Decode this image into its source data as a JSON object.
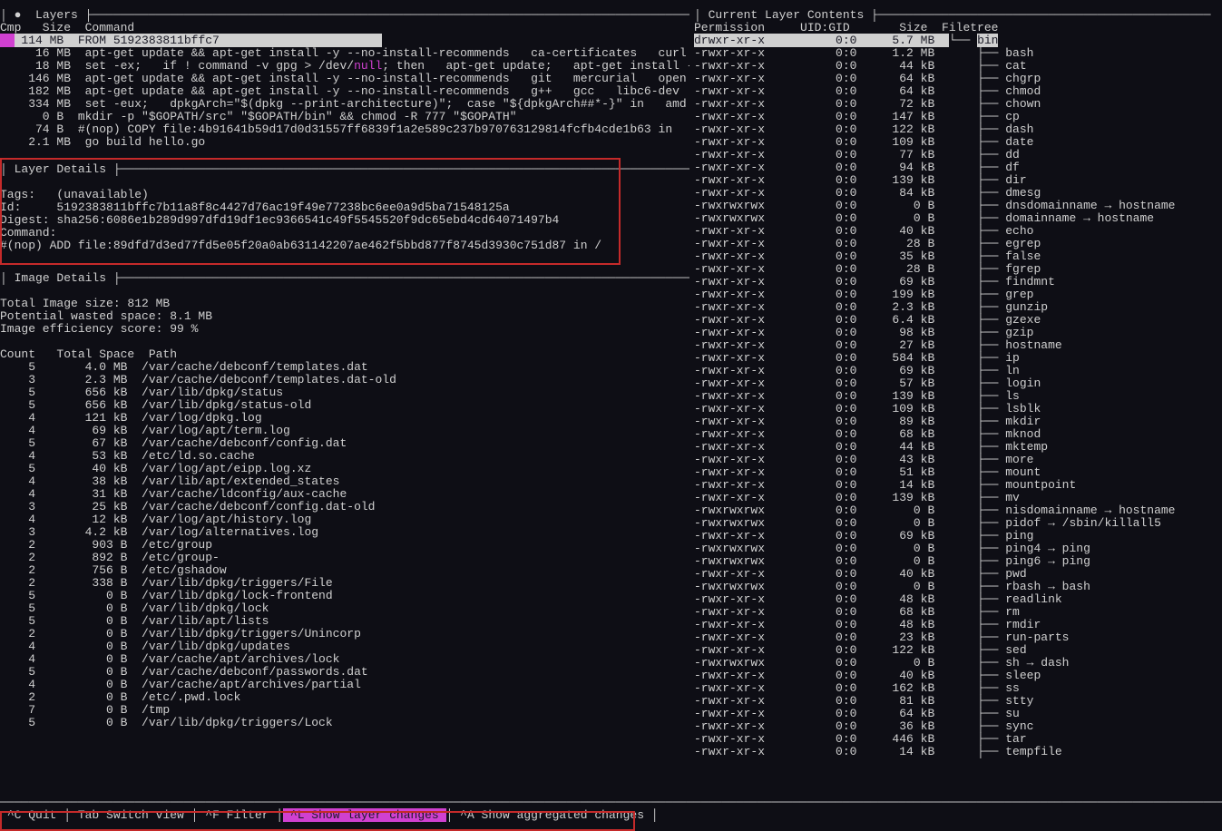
{
  "headers": {
    "layers_title": " Layers ",
    "layers_cols": "Cmp   Size  Command",
    "contents_title": " Current Layer Contents ",
    "contents_cols": "Permission     UID:GID       Size  Filetree",
    "layerdet_title": " Layer Details ",
    "imagedet_title": " Image Details "
  },
  "layers": [
    {
      "sel": true,
      "cmp": "",
      "size": " 114 MB",
      "cmd": "FROM 5192383811bffc7                       "
    },
    {
      "sel": false,
      "cmp": "",
      "size": "  16 MB",
      "cmd": "apt-get update && apt-get install -y --no-install-recommends   ca-certificates   curl"
    },
    {
      "sel": false,
      "cmp": "",
      "size": "  18 MB",
      "cmd": "set -ex;   if ! command -v gpg > /dev/",
      "hl": "null",
      "cmd2": "; then   apt-get update;   apt-get install -"
    },
    {
      "sel": false,
      "cmp": "",
      "size": " 146 MB",
      "cmd": "apt-get update && apt-get install -y --no-install-recommends   git   mercurial   open"
    },
    {
      "sel": false,
      "cmp": "",
      "size": " 182 MB",
      "cmd": "apt-get update && apt-get install -y --no-install-recommends   g++   gcc   libc6-dev  "
    },
    {
      "sel": false,
      "cmp": "",
      "size": " 334 MB",
      "cmd": "set -eux;   dpkgArch=\"$(dpkg --print-architecture)\";  case \"${dpkgArch##*-}\" in   amd"
    },
    {
      "sel": false,
      "cmp": "",
      "size": "   0 B",
      "cmd": "mkdir -p \"$GOPATH/src\" \"$GOPATH/bin\" && chmod -R 777 \"$GOPATH\""
    },
    {
      "sel": false,
      "cmp": "",
      "size": "  74 B",
      "cmd": "#(nop) COPY file:4b91641b59d17d0d31557ff6839f1a2e589c237b970763129814fcfb4cde1b63 in"
    },
    {
      "sel": false,
      "cmp": "",
      "size": " 2.1 MB",
      "cmd": "go build hello.go"
    }
  ],
  "layer_details": {
    "tags": "Tags:   (unavailable)",
    "id": "Id:     5192383811bffc7b11a8f8c4427d76ac19f49e77238bc6ee0a9d5ba71548125a",
    "digest": "Digest: sha256:6086e1b289d997dfd19df1ec9366541c49f5545520f9dc65ebd4cd64071497b4",
    "cmdlbl": "Command:",
    "cmd": "#(nop) ADD file:89dfd7d3ed77fd5e05f20a0ab631142207ae462f5bbd877f8745d3930c751d87 in /"
  },
  "image_details": {
    "total": "Total Image size: 812 MB",
    "wasted": "Potential wasted space: 8.1 MB",
    "eff": "Image efficiency score: 99 %",
    "hdr": "Count   Total Space  Path"
  },
  "wasted": [
    {
      "c": "    5",
      "s": "       4.0 MB",
      "p": "/var/cache/debconf/templates.dat"
    },
    {
      "c": "    3",
      "s": "       2.3 MB",
      "p": "/var/cache/debconf/templates.dat-old"
    },
    {
      "c": "    5",
      "s": "       656 kB",
      "p": "/var/lib/dpkg/status"
    },
    {
      "c": "    5",
      "s": "       656 kB",
      "p": "/var/lib/dpkg/status-old"
    },
    {
      "c": "    4",
      "s": "       121 kB",
      "p": "/var/log/dpkg.log"
    },
    {
      "c": "    4",
      "s": "        69 kB",
      "p": "/var/log/apt/term.log"
    },
    {
      "c": "    5",
      "s": "        67 kB",
      "p": "/var/cache/debconf/config.dat"
    },
    {
      "c": "    4",
      "s": "        53 kB",
      "p": "/etc/ld.so.cache"
    },
    {
      "c": "    5",
      "s": "        40 kB",
      "p": "/var/log/apt/eipp.log.xz"
    },
    {
      "c": "    4",
      "s": "        38 kB",
      "p": "/var/lib/apt/extended_states"
    },
    {
      "c": "    4",
      "s": "        31 kB",
      "p": "/var/cache/ldconfig/aux-cache"
    },
    {
      "c": "    3",
      "s": "        25 kB",
      "p": "/var/cache/debconf/config.dat-old"
    },
    {
      "c": "    4",
      "s": "        12 kB",
      "p": "/var/log/apt/history.log"
    },
    {
      "c": "    3",
      "s": "       4.2 kB",
      "p": "/var/log/alternatives.log"
    },
    {
      "c": "    2",
      "s": "        903 B",
      "p": "/etc/group"
    },
    {
      "c": "    2",
      "s": "        892 B",
      "p": "/etc/group-"
    },
    {
      "c": "    2",
      "s": "        756 B",
      "p": "/etc/gshadow"
    },
    {
      "c": "    2",
      "s": "        338 B",
      "p": "/var/lib/dpkg/triggers/File"
    },
    {
      "c": "    5",
      "s": "          0 B",
      "p": "/var/lib/dpkg/lock-frontend"
    },
    {
      "c": "    5",
      "s": "          0 B",
      "p": "/var/lib/dpkg/lock"
    },
    {
      "c": "    5",
      "s": "          0 B",
      "p": "/var/lib/apt/lists"
    },
    {
      "c": "    2",
      "s": "          0 B",
      "p": "/var/lib/dpkg/triggers/Unincorp"
    },
    {
      "c": "    4",
      "s": "          0 B",
      "p": "/var/lib/dpkg/updates"
    },
    {
      "c": "    4",
      "s": "          0 B",
      "p": "/var/cache/apt/archives/lock"
    },
    {
      "c": "    5",
      "s": "          0 B",
      "p": "/var/cache/debconf/passwords.dat"
    },
    {
      "c": "    4",
      "s": "          0 B",
      "p": "/var/cache/apt/archives/partial"
    },
    {
      "c": "    2",
      "s": "          0 B",
      "p": "/etc/.pwd.lock"
    },
    {
      "c": "    7",
      "s": "          0 B",
      "p": "/tmp"
    },
    {
      "c": "    5",
      "s": "          0 B",
      "p": "/var/lib/dpkg/triggers/Lock"
    }
  ],
  "filetree_root": {
    "perm": "drwxr-xr-x",
    "ug": "0:0",
    "size": "5.7 MB",
    "glyph": "└── ",
    "name": "bin",
    "sel": true
  },
  "files": [
    {
      "perm": "-rwxr-xr-x",
      "ug": "0:0",
      "size": "1.2 MB",
      "name": "bash"
    },
    {
      "perm": "-rwxr-xr-x",
      "ug": "0:0",
      "size": "44 kB",
      "name": "cat"
    },
    {
      "perm": "-rwxr-xr-x",
      "ug": "0:0",
      "size": "64 kB",
      "name": "chgrp"
    },
    {
      "perm": "-rwxr-xr-x",
      "ug": "0:0",
      "size": "64 kB",
      "name": "chmod"
    },
    {
      "perm": "-rwxr-xr-x",
      "ug": "0:0",
      "size": "72 kB",
      "name": "chown"
    },
    {
      "perm": "-rwxr-xr-x",
      "ug": "0:0",
      "size": "147 kB",
      "name": "cp"
    },
    {
      "perm": "-rwxr-xr-x",
      "ug": "0:0",
      "size": "122 kB",
      "name": "dash"
    },
    {
      "perm": "-rwxr-xr-x",
      "ug": "0:0",
      "size": "109 kB",
      "name": "date"
    },
    {
      "perm": "-rwxr-xr-x",
      "ug": "0:0",
      "size": "77 kB",
      "name": "dd"
    },
    {
      "perm": "-rwxr-xr-x",
      "ug": "0:0",
      "size": "94 kB",
      "name": "df"
    },
    {
      "perm": "-rwxr-xr-x",
      "ug": "0:0",
      "size": "139 kB",
      "name": "dir"
    },
    {
      "perm": "-rwxr-xr-x",
      "ug": "0:0",
      "size": "84 kB",
      "name": "dmesg"
    },
    {
      "perm": "-rwxrwxrwx",
      "ug": "0:0",
      "size": "0 B",
      "name": "dnsdomainname → hostname"
    },
    {
      "perm": "-rwxrwxrwx",
      "ug": "0:0",
      "size": "0 B",
      "name": "domainname → hostname"
    },
    {
      "perm": "-rwxr-xr-x",
      "ug": "0:0",
      "size": "40 kB",
      "name": "echo"
    },
    {
      "perm": "-rwxr-xr-x",
      "ug": "0:0",
      "size": "28 B",
      "name": "egrep"
    },
    {
      "perm": "-rwxr-xr-x",
      "ug": "0:0",
      "size": "35 kB",
      "name": "false"
    },
    {
      "perm": "-rwxr-xr-x",
      "ug": "0:0",
      "size": "28 B",
      "name": "fgrep"
    },
    {
      "perm": "-rwxr-xr-x",
      "ug": "0:0",
      "size": "69 kB",
      "name": "findmnt"
    },
    {
      "perm": "-rwxr-xr-x",
      "ug": "0:0",
      "size": "199 kB",
      "name": "grep"
    },
    {
      "perm": "-rwxr-xr-x",
      "ug": "0:0",
      "size": "2.3 kB",
      "name": "gunzip"
    },
    {
      "perm": "-rwxr-xr-x",
      "ug": "0:0",
      "size": "6.4 kB",
      "name": "gzexe"
    },
    {
      "perm": "-rwxr-xr-x",
      "ug": "0:0",
      "size": "98 kB",
      "name": "gzip"
    },
    {
      "perm": "-rwxr-xr-x",
      "ug": "0:0",
      "size": "27 kB",
      "name": "hostname"
    },
    {
      "perm": "-rwxr-xr-x",
      "ug": "0:0",
      "size": "584 kB",
      "name": "ip"
    },
    {
      "perm": "-rwxr-xr-x",
      "ug": "0:0",
      "size": "69 kB",
      "name": "ln"
    },
    {
      "perm": "-rwxr-xr-x",
      "ug": "0:0",
      "size": "57 kB",
      "name": "login"
    },
    {
      "perm": "-rwxr-xr-x",
      "ug": "0:0",
      "size": "139 kB",
      "name": "ls"
    },
    {
      "perm": "-rwxr-xr-x",
      "ug": "0:0",
      "size": "109 kB",
      "name": "lsblk"
    },
    {
      "perm": "-rwxr-xr-x",
      "ug": "0:0",
      "size": "89 kB",
      "name": "mkdir"
    },
    {
      "perm": "-rwxr-xr-x",
      "ug": "0:0",
      "size": "68 kB",
      "name": "mknod"
    },
    {
      "perm": "-rwxr-xr-x",
      "ug": "0:0",
      "size": "44 kB",
      "name": "mktemp"
    },
    {
      "perm": "-rwxr-xr-x",
      "ug": "0:0",
      "size": "43 kB",
      "name": "more"
    },
    {
      "perm": "-rwxr-xr-x",
      "ug": "0:0",
      "size": "51 kB",
      "name": "mount"
    },
    {
      "perm": "-rwxr-xr-x",
      "ug": "0:0",
      "size": "14 kB",
      "name": "mountpoint"
    },
    {
      "perm": "-rwxr-xr-x",
      "ug": "0:0",
      "size": "139 kB",
      "name": "mv"
    },
    {
      "perm": "-rwxrwxrwx",
      "ug": "0:0",
      "size": "0 B",
      "name": "nisdomainname → hostname"
    },
    {
      "perm": "-rwxrwxrwx",
      "ug": "0:0",
      "size": "0 B",
      "name": "pidof → /sbin/killall5"
    },
    {
      "perm": "-rwxr-xr-x",
      "ug": "0:0",
      "size": "69 kB",
      "name": "ping"
    },
    {
      "perm": "-rwxrwxrwx",
      "ug": "0:0",
      "size": "0 B",
      "name": "ping4 → ping"
    },
    {
      "perm": "-rwxrwxrwx",
      "ug": "0:0",
      "size": "0 B",
      "name": "ping6 → ping"
    },
    {
      "perm": "-rwxr-xr-x",
      "ug": "0:0",
      "size": "40 kB",
      "name": "pwd"
    },
    {
      "perm": "-rwxrwxrwx",
      "ug": "0:0",
      "size": "0 B",
      "name": "rbash → bash"
    },
    {
      "perm": "-rwxr-xr-x",
      "ug": "0:0",
      "size": "48 kB",
      "name": "readlink"
    },
    {
      "perm": "-rwxr-xr-x",
      "ug": "0:0",
      "size": "68 kB",
      "name": "rm"
    },
    {
      "perm": "-rwxr-xr-x",
      "ug": "0:0",
      "size": "48 kB",
      "name": "rmdir"
    },
    {
      "perm": "-rwxr-xr-x",
      "ug": "0:0",
      "size": "23 kB",
      "name": "run-parts"
    },
    {
      "perm": "-rwxr-xr-x",
      "ug": "0:0",
      "size": "122 kB",
      "name": "sed"
    },
    {
      "perm": "-rwxrwxrwx",
      "ug": "0:0",
      "size": "0 B",
      "name": "sh → dash"
    },
    {
      "perm": "-rwxr-xr-x",
      "ug": "0:0",
      "size": "40 kB",
      "name": "sleep"
    },
    {
      "perm": "-rwxr-xr-x",
      "ug": "0:0",
      "size": "162 kB",
      "name": "ss"
    },
    {
      "perm": "-rwxr-xr-x",
      "ug": "0:0",
      "size": "81 kB",
      "name": "stty"
    },
    {
      "perm": "-rwxr-xr-x",
      "ug": "0:0",
      "size": "64 kB",
      "name": "su"
    },
    {
      "perm": "-rwxr-xr-x",
      "ug": "0:0",
      "size": "36 kB",
      "name": "sync"
    },
    {
      "perm": "-rwxr-xr-x",
      "ug": "0:0",
      "size": "446 kB",
      "name": "tar"
    },
    {
      "perm": "-rwxr-xr-x",
      "ug": "0:0",
      "size": "14 kB",
      "name": "tempfile"
    }
  ],
  "footer": {
    "quit": "^C Quit",
    "tab": "Tab Switch view",
    "filter": "^F Filter",
    "layer": "^L Show layer changes",
    "agg": "^A Show aggregated changes"
  }
}
